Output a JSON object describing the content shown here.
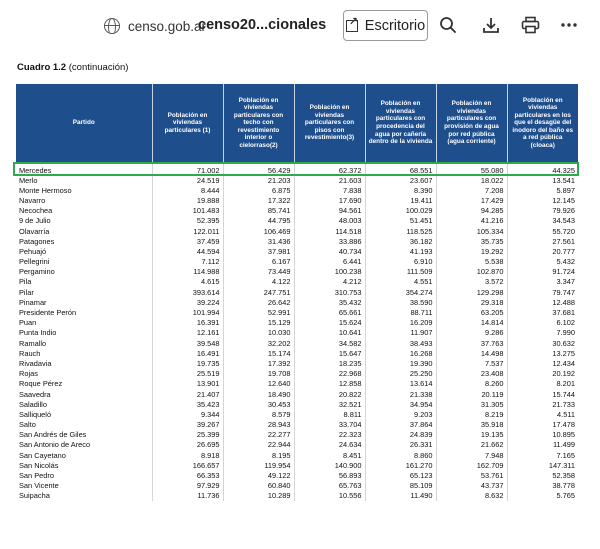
{
  "toolbar": {
    "domain": "censo.gob.ar",
    "doc_title": "censo20...cionales",
    "open_label": "Escritorio",
    "icons": [
      "globe-icon",
      "chevron-down-icon",
      "open-external-icon",
      "search-icon",
      "download-icon",
      "print-icon",
      "more-icon"
    ]
  },
  "document": {
    "caption_bold": "Cuadro 1.2",
    "caption_rest": " (continuación)"
  },
  "table": {
    "headers": [
      "Partido",
      "Población en viviendas particulares (1)",
      "Población en viviendas particulares con techo con revestimiento interior o cielorraso(2)",
      "Población en viviendas particulares con pisos con revestimiento(3)",
      "Población en viviendas particulares con procedencia del agua por cañería dentro de la vivienda",
      "Población en viviendas particulares con provisión de agua por red pública (agua corriente)",
      "Población en viviendas particulares en los que el desagüe del inodoro del baño es a red pública (cloaca)"
    ],
    "rows": [
      [
        "Mercedes",
        "71.002",
        "56.429",
        "62.372",
        "68.551",
        "55.080",
        "44.325"
      ],
      [
        "Merlo",
        "24.519",
        "21.203",
        "21.603",
        "23.607",
        "18.022",
        "13.541"
      ],
      [
        "Monte Hermoso",
        "8.444",
        "6.875",
        "7.838",
        "8.390",
        "7.208",
        "5.897"
      ],
      [
        "Navarro",
        "19.888",
        "17.322",
        "17.690",
        "19.411",
        "17.429",
        "12.145"
      ],
      [
        "Necochea",
        "101.483",
        "85.741",
        "94.561",
        "100.029",
        "94.285",
        "79.926"
      ],
      [
        "9 de Julio",
        "52.395",
        "44.795",
        "48.003",
        "51.451",
        "41.216",
        "34.543"
      ],
      [
        "Olavarría",
        "122.011",
        "106.469",
        "114.518",
        "118.525",
        "105.334",
        "55.720"
      ],
      [
        "Patagones",
        "37.459",
        "31.436",
        "33.886",
        "36.182",
        "35.735",
        "27.561"
      ],
      [
        "Pehuajó",
        "44.594",
        "37.981",
        "40.734",
        "41.193",
        "19.292",
        "20.777"
      ],
      [
        "Pellegrini",
        "7.112",
        "6.167",
        "6.441",
        "6.910",
        "5.538",
        "5.432"
      ],
      [
        "Pergamino",
        "114.988",
        "73.449",
        "100.238",
        "111.509",
        "102.870",
        "91.724"
      ],
      [
        "Pila",
        "4.615",
        "4.122",
        "4.212",
        "4.551",
        "3.572",
        "3.347"
      ],
      [
        "Pilar",
        "393.614",
        "247.751",
        "310.753",
        "354.274",
        "129.298",
        "79.747"
      ],
      [
        "Pinamar",
        "39.224",
        "26.642",
        "35.432",
        "38.590",
        "29.318",
        "12.488"
      ],
      [
        "Presidente Perón",
        "101.994",
        "52.991",
        "65.661",
        "88.711",
        "63.205",
        "37.681"
      ],
      [
        "Puan",
        "16.391",
        "15.129",
        "15.624",
        "16.209",
        "14.814",
        "6.102"
      ],
      [
        "Punta Indio",
        "12.161",
        "10.030",
        "10.641",
        "11.907",
        "9.286",
        "7.990"
      ],
      [
        "Ramallo",
        "39.548",
        "32.202",
        "34.582",
        "38.493",
        "37.763",
        "30.632"
      ],
      [
        "Rauch",
        "16.491",
        "15.174",
        "15.647",
        "16.268",
        "14.498",
        "13.275"
      ],
      [
        "Rivadavia",
        "19.735",
        "17.392",
        "18.235",
        "19.390",
        "7.537",
        "12.434"
      ],
      [
        "Rojas",
        "25.519",
        "19.708",
        "22.968",
        "25.250",
        "23.408",
        "20.192"
      ],
      [
        "Roque Pérez",
        "13.901",
        "12.640",
        "12.858",
        "13.614",
        "8.260",
        "8.201"
      ],
      [
        "Saavedra",
        "21.407",
        "18.490",
        "20.822",
        "21.338",
        "20.119",
        "15.744"
      ],
      [
        "Saladillo",
        "35.423",
        "30.453",
        "32.521",
        "34.954",
        "31.305",
        "21.733"
      ],
      [
        "Salliqueló",
        "9.344",
        "8.579",
        "8.811",
        "9.203",
        "8.219",
        "4.511"
      ],
      [
        "Salto",
        "39.267",
        "28.943",
        "33.704",
        "37.864",
        "35.918",
        "17.478"
      ],
      [
        "San Andrés de Giles",
        "25.399",
        "22.277",
        "22.323",
        "24.839",
        "19.135",
        "10.895"
      ],
      [
        "San Antonio de Areco",
        "26.695",
        "22.944",
        "24.634",
        "26.331",
        "21.662",
        "11.499"
      ],
      [
        "San Cayetano",
        "8.918",
        "8.195",
        "8.451",
        "8.860",
        "7.948",
        "7.165"
      ],
      [
        "San Nicolás",
        "166.657",
        "119.954",
        "140.900",
        "161.270",
        "162.709",
        "147.311"
      ],
      [
        "San Pedro",
        "66.353",
        "49.122",
        "56.893",
        "65.123",
        "53.761",
        "52.358"
      ],
      [
        "San Vicente",
        "97.929",
        "60.840",
        "65.763",
        "85.109",
        "43.737",
        "38.778"
      ],
      [
        "Suipacha",
        "11.736",
        "10.289",
        "10.556",
        "11.490",
        "8.632",
        "5.765"
      ]
    ]
  }
}
